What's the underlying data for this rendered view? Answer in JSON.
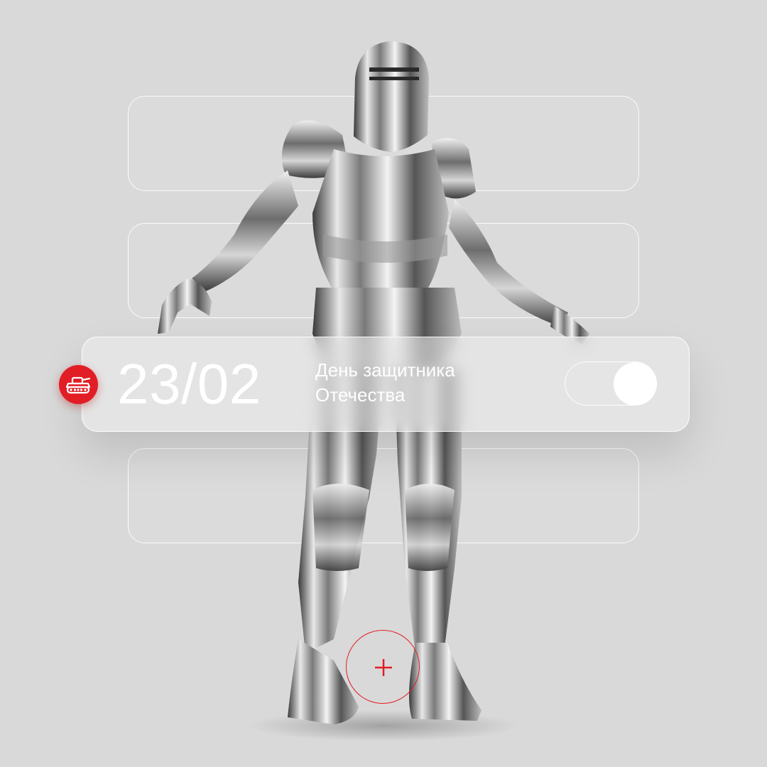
{
  "card": {
    "date": "23/02",
    "title_line1": "День защитника",
    "title_line2": "Отечества",
    "toggle_state": "on"
  },
  "icons": {
    "badge": "tank-icon",
    "marker": "plus-icon"
  },
  "colors": {
    "background": "#d9d9d9",
    "accent": "#e11d25",
    "text": "#ffffff"
  }
}
